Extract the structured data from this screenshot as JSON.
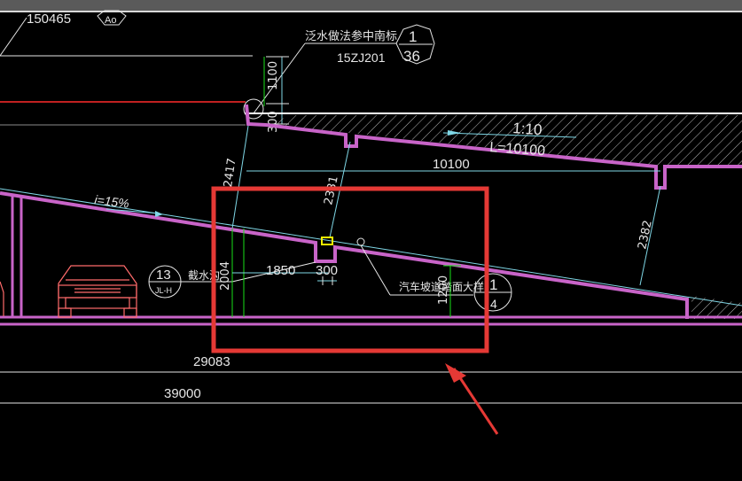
{
  "top_bar": {
    "partial_label_left": "150465",
    "partial_label_symbol": "Ao"
  },
  "callouts": {
    "waterproof_ref": {
      "text": "泛水做法参中南标",
      "atlas": "15ZJ201",
      "sheet_top": "1",
      "sheet_bottom": "36"
    },
    "drain_ref": {
      "text": "截水沟",
      "sheet_top": "13",
      "sheet_bottom": "JL-H"
    },
    "ramp_detail_ref": {
      "text": "汽车坡道踏面大样",
      "sheet_top": "1",
      "sheet_bottom": "4"
    }
  },
  "dimensions": {
    "d1100": "1100",
    "d300_top": "300",
    "d2417": "2417",
    "d2331": "2331",
    "slope_upper": "1:10",
    "length_upper": "L=10100",
    "d10100": "10100",
    "d2382": "2382",
    "slope_lower": "i=15%",
    "d2004": "2004",
    "d1850": "1850",
    "d300_trench": "300",
    "d1200": "1200",
    "d29083": "29083",
    "d39000": "39000"
  },
  "colors": {
    "background": "#000000",
    "slab_magenta": "#c864c8",
    "white_line": "#ffffff",
    "cyan_line": "#7fd7e6",
    "green_dim": "#19e019",
    "red_car": "#ff6b6b",
    "highlight_box": "#e53935",
    "yellow_mark": "#f0f000"
  }
}
